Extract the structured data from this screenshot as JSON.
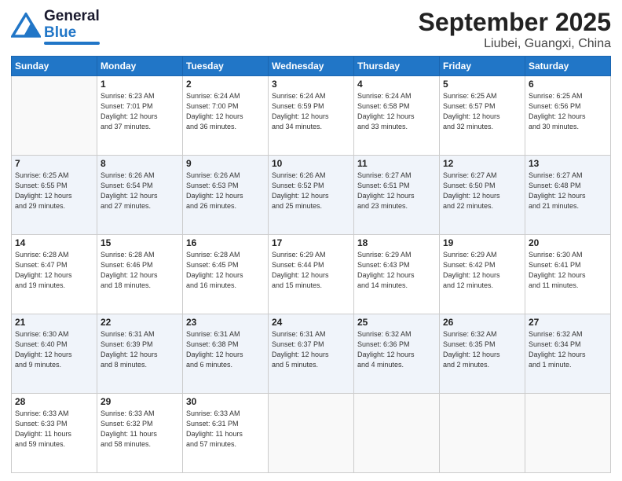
{
  "logo": {
    "line1": "General",
    "line2": "Blue"
  },
  "header": {
    "month": "September 2025",
    "location": "Liubei, Guangxi, China"
  },
  "weekdays": [
    "Sunday",
    "Monday",
    "Tuesday",
    "Wednesday",
    "Thursday",
    "Friday",
    "Saturday"
  ],
  "weeks": [
    [
      {
        "day": "",
        "info": ""
      },
      {
        "day": "1",
        "info": "Sunrise: 6:23 AM\nSunset: 7:01 PM\nDaylight: 12 hours\nand 37 minutes."
      },
      {
        "day": "2",
        "info": "Sunrise: 6:24 AM\nSunset: 7:00 PM\nDaylight: 12 hours\nand 36 minutes."
      },
      {
        "day": "3",
        "info": "Sunrise: 6:24 AM\nSunset: 6:59 PM\nDaylight: 12 hours\nand 34 minutes."
      },
      {
        "day": "4",
        "info": "Sunrise: 6:24 AM\nSunset: 6:58 PM\nDaylight: 12 hours\nand 33 minutes."
      },
      {
        "day": "5",
        "info": "Sunrise: 6:25 AM\nSunset: 6:57 PM\nDaylight: 12 hours\nand 32 minutes."
      },
      {
        "day": "6",
        "info": "Sunrise: 6:25 AM\nSunset: 6:56 PM\nDaylight: 12 hours\nand 30 minutes."
      }
    ],
    [
      {
        "day": "7",
        "info": "Sunrise: 6:25 AM\nSunset: 6:55 PM\nDaylight: 12 hours\nand 29 minutes."
      },
      {
        "day": "8",
        "info": "Sunrise: 6:26 AM\nSunset: 6:54 PM\nDaylight: 12 hours\nand 27 minutes."
      },
      {
        "day": "9",
        "info": "Sunrise: 6:26 AM\nSunset: 6:53 PM\nDaylight: 12 hours\nand 26 minutes."
      },
      {
        "day": "10",
        "info": "Sunrise: 6:26 AM\nSunset: 6:52 PM\nDaylight: 12 hours\nand 25 minutes."
      },
      {
        "day": "11",
        "info": "Sunrise: 6:27 AM\nSunset: 6:51 PM\nDaylight: 12 hours\nand 23 minutes."
      },
      {
        "day": "12",
        "info": "Sunrise: 6:27 AM\nSunset: 6:50 PM\nDaylight: 12 hours\nand 22 minutes."
      },
      {
        "day": "13",
        "info": "Sunrise: 6:27 AM\nSunset: 6:48 PM\nDaylight: 12 hours\nand 21 minutes."
      }
    ],
    [
      {
        "day": "14",
        "info": "Sunrise: 6:28 AM\nSunset: 6:47 PM\nDaylight: 12 hours\nand 19 minutes."
      },
      {
        "day": "15",
        "info": "Sunrise: 6:28 AM\nSunset: 6:46 PM\nDaylight: 12 hours\nand 18 minutes."
      },
      {
        "day": "16",
        "info": "Sunrise: 6:28 AM\nSunset: 6:45 PM\nDaylight: 12 hours\nand 16 minutes."
      },
      {
        "day": "17",
        "info": "Sunrise: 6:29 AM\nSunset: 6:44 PM\nDaylight: 12 hours\nand 15 minutes."
      },
      {
        "day": "18",
        "info": "Sunrise: 6:29 AM\nSunset: 6:43 PM\nDaylight: 12 hours\nand 14 minutes."
      },
      {
        "day": "19",
        "info": "Sunrise: 6:29 AM\nSunset: 6:42 PM\nDaylight: 12 hours\nand 12 minutes."
      },
      {
        "day": "20",
        "info": "Sunrise: 6:30 AM\nSunset: 6:41 PM\nDaylight: 12 hours\nand 11 minutes."
      }
    ],
    [
      {
        "day": "21",
        "info": "Sunrise: 6:30 AM\nSunset: 6:40 PM\nDaylight: 12 hours\nand 9 minutes."
      },
      {
        "day": "22",
        "info": "Sunrise: 6:31 AM\nSunset: 6:39 PM\nDaylight: 12 hours\nand 8 minutes."
      },
      {
        "day": "23",
        "info": "Sunrise: 6:31 AM\nSunset: 6:38 PM\nDaylight: 12 hours\nand 6 minutes."
      },
      {
        "day": "24",
        "info": "Sunrise: 6:31 AM\nSunset: 6:37 PM\nDaylight: 12 hours\nand 5 minutes."
      },
      {
        "day": "25",
        "info": "Sunrise: 6:32 AM\nSunset: 6:36 PM\nDaylight: 12 hours\nand 4 minutes."
      },
      {
        "day": "26",
        "info": "Sunrise: 6:32 AM\nSunset: 6:35 PM\nDaylight: 12 hours\nand 2 minutes."
      },
      {
        "day": "27",
        "info": "Sunrise: 6:32 AM\nSunset: 6:34 PM\nDaylight: 12 hours\nand 1 minute."
      }
    ],
    [
      {
        "day": "28",
        "info": "Sunrise: 6:33 AM\nSunset: 6:33 PM\nDaylight: 11 hours\nand 59 minutes."
      },
      {
        "day": "29",
        "info": "Sunrise: 6:33 AM\nSunset: 6:32 PM\nDaylight: 11 hours\nand 58 minutes."
      },
      {
        "day": "30",
        "info": "Sunrise: 6:33 AM\nSunset: 6:31 PM\nDaylight: 11 hours\nand 57 minutes."
      },
      {
        "day": "",
        "info": ""
      },
      {
        "day": "",
        "info": ""
      },
      {
        "day": "",
        "info": ""
      },
      {
        "day": "",
        "info": ""
      }
    ]
  ]
}
